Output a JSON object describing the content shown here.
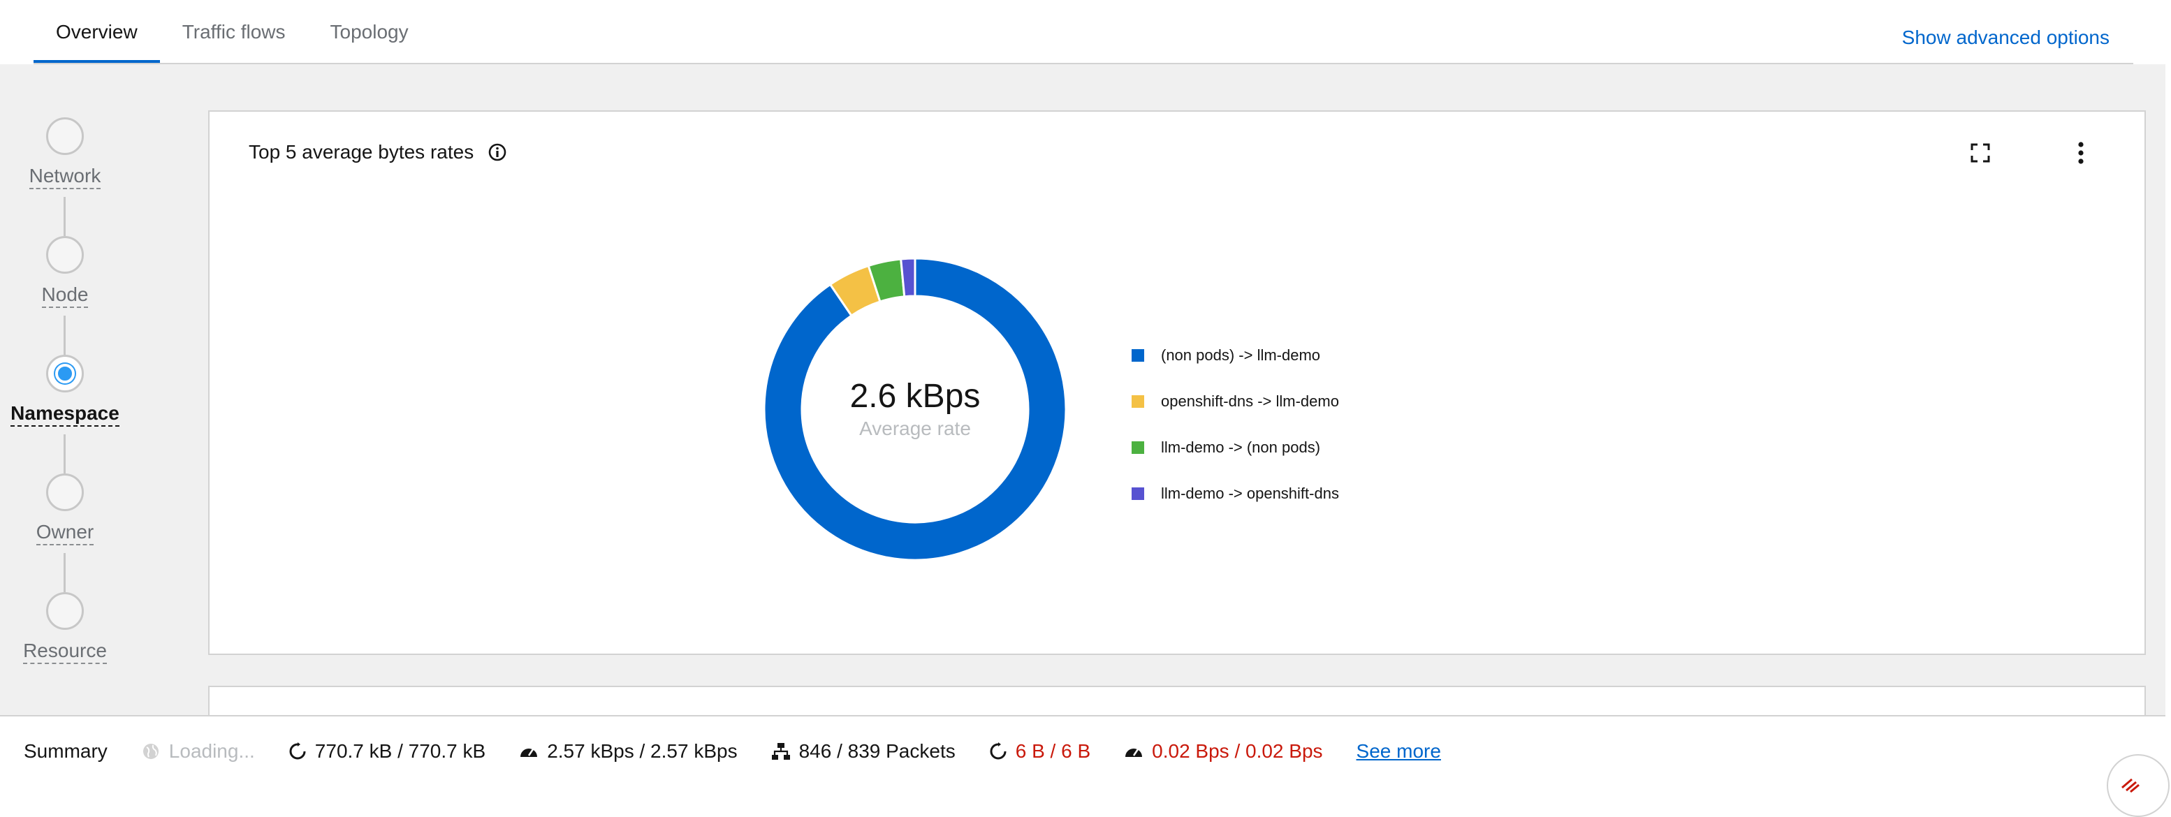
{
  "tabs": [
    {
      "label": "Overview",
      "active": true
    },
    {
      "label": "Traffic flows",
      "active": false
    },
    {
      "label": "Topology",
      "active": false
    }
  ],
  "advanced_options_label": "Show advanced options",
  "scope_stepper": {
    "steps": [
      {
        "label": "Network",
        "selected": false
      },
      {
        "label": "Node",
        "selected": false
      },
      {
        "label": "Namespace",
        "selected": true
      },
      {
        "label": "Owner",
        "selected": false
      },
      {
        "label": "Resource",
        "selected": false
      }
    ]
  },
  "card": {
    "title": "Top 5 average bytes rates",
    "icons": [
      "info-icon",
      "expand-icon",
      "kebab-icon"
    ],
    "center_value": "2.6 kBps",
    "center_label": "Average rate",
    "legend": [
      {
        "label": "(non pods) -> llm-demo",
        "color": "#0066cc"
      },
      {
        "label": "openshift-dns -> llm-demo",
        "color": "#f4c145"
      },
      {
        "label": "llm-demo -> (non pods)",
        "color": "#4cb140"
      },
      {
        "label": "llm-demo -> openshift-dns",
        "color": "#5752d1"
      }
    ]
  },
  "chart_data": {
    "type": "pie",
    "title": "Top 5 average bytes rates",
    "categories": [
      "(non pods) -> llm-demo",
      "openshift-dns -> llm-demo",
      "llm-demo -> (non pods)",
      "llm-demo -> openshift-dns"
    ],
    "values": [
      90.5,
      4.5,
      3.5,
      1.5
    ],
    "colors": [
      "#0066cc",
      "#f4c145",
      "#4cb140",
      "#5752d1"
    ],
    "donut": true
  },
  "summary": {
    "title": "Summary",
    "loading": "Loading...",
    "bytes": "770.7 kB / 770.7 kB",
    "byte_rate": "2.57 kBps / 2.57 kBps",
    "packets": "846 / 839 Packets",
    "dropped_bytes": "6 B / 6 B",
    "dropped_rate": "0.02 Bps / 0.02 Bps",
    "see_more": "See more"
  }
}
